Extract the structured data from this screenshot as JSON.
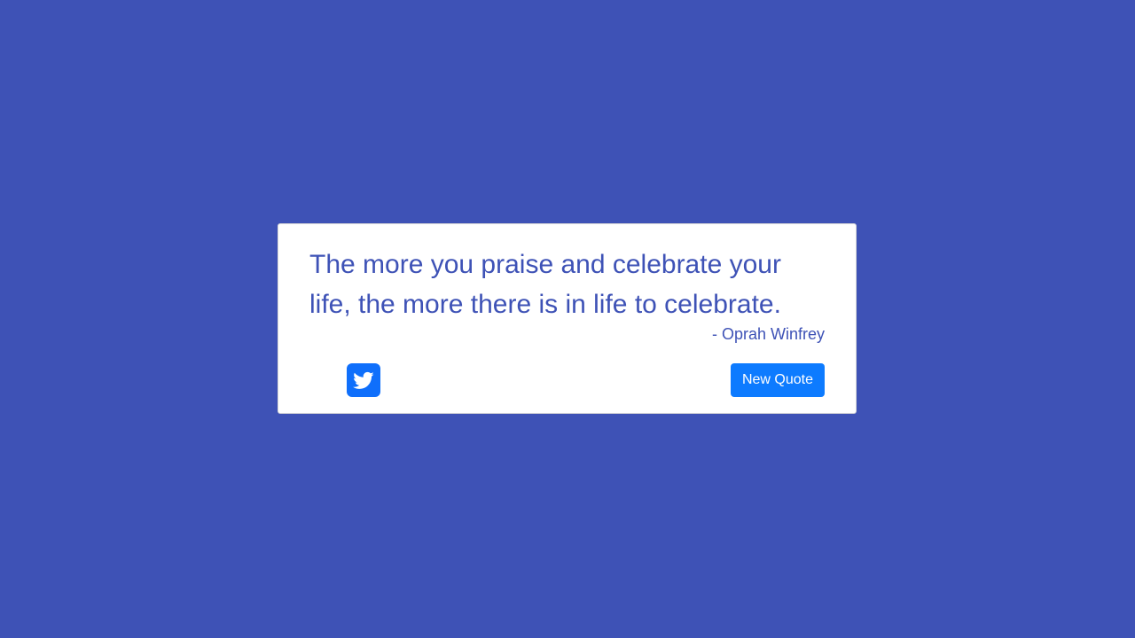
{
  "colors": {
    "background": "#3e52b6",
    "card": "#ffffff",
    "text": "#3e52b6",
    "button": "#0d7bff",
    "tweet_icon_bg": "#0f6ffb"
  },
  "quote": {
    "text": "The more you praise and celebrate your life, the more there is in life to celebrate.",
    "author": "- Oprah Winfrey"
  },
  "actions": {
    "tweet_icon": "twitter-icon",
    "new_quote_label": "New Quote"
  }
}
